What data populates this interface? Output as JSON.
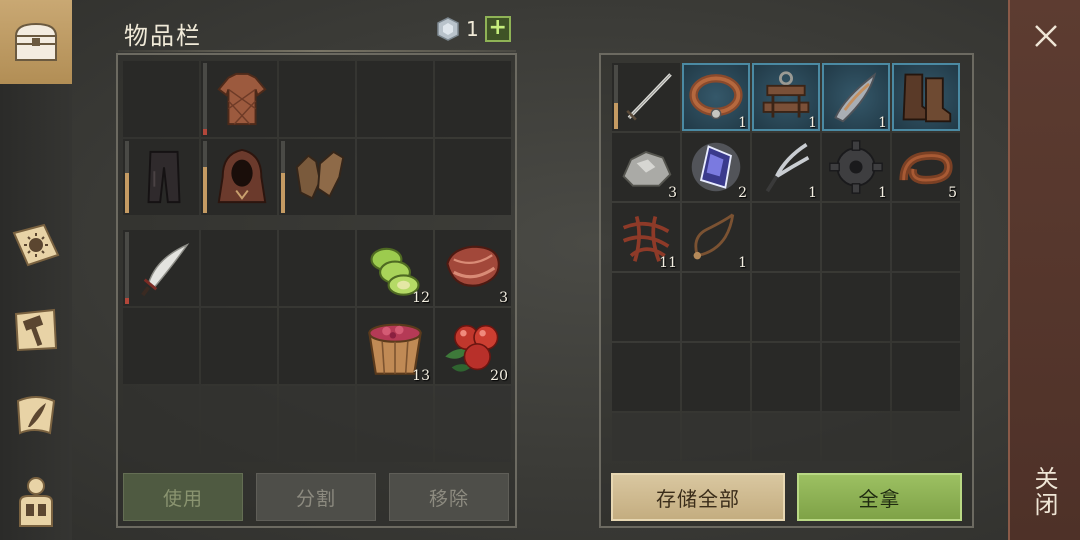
{
  "inventory": {
    "title": "物品栏",
    "currency_value": "1",
    "plus_label": "+"
  },
  "buttons": {
    "use": "使用",
    "split": "分割",
    "remove": "移除",
    "store_all": "存储全部",
    "take_all": "全拿",
    "close": "关闭"
  },
  "equipment_slots": [
    {
      "item": null
    },
    {
      "item": "chest-armor-icon"
    },
    {
      "item": null
    },
    {
      "item": null
    },
    {
      "item": null
    },
    {
      "item": "pants-icon"
    },
    {
      "item": "hood-icon"
    },
    {
      "item": "gloves-icon"
    },
    {
      "item": null
    },
    {
      "item": null
    }
  ],
  "backpack_slots": [
    {
      "item": "scimitar-icon",
      "qty": ""
    },
    {
      "item": null
    },
    {
      "item": null
    },
    {
      "item": "cactus-slices-icon",
      "qty": "12"
    },
    {
      "item": "raw-meat-icon",
      "qty": "3"
    },
    {
      "item": null
    },
    {
      "item": null
    },
    {
      "item": null
    },
    {
      "item": "berry-bucket-icon",
      "qty": "13"
    },
    {
      "item": "berries-icon",
      "qty": "20"
    }
  ],
  "storage_slots": [
    {
      "item": "sword-icon",
      "qty": ""
    },
    {
      "item": "collar-icon",
      "qty": "1"
    },
    {
      "item": "shackle-icon",
      "qty": "1"
    },
    {
      "item": "blade-fragment-icon",
      "qty": "1"
    },
    {
      "item": "boots-icon",
      "qty": ""
    },
    {
      "item": "iron-ore-icon",
      "qty": "3"
    },
    {
      "item": "crystal-icon",
      "qty": "2"
    },
    {
      "item": "fork-blade-icon",
      "qty": "1"
    },
    {
      "item": "gear-part-icon",
      "qty": "1"
    },
    {
      "item": "leather-strap-icon",
      "qty": "5"
    },
    {
      "item": "tangled-roots-icon",
      "qty": "11"
    },
    {
      "item": "rope-icon",
      "qty": "1"
    }
  ],
  "colors": {
    "accent_tan": "#c9a873",
    "take_green": "#8fb356",
    "slot_highlight": "#4b8aa3",
    "close_bg": "#5d3c31"
  }
}
